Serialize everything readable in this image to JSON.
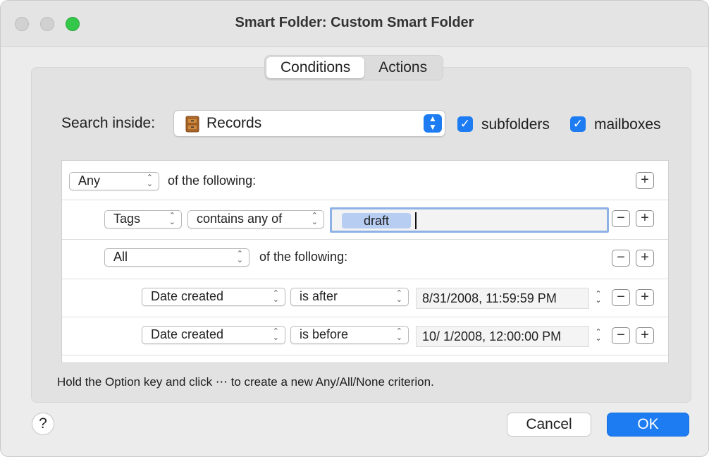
{
  "window": {
    "title": "Smart Folder: Custom Smart Folder"
  },
  "tabs": [
    {
      "label": "Conditions",
      "active": true
    },
    {
      "label": "Actions",
      "active": false
    }
  ],
  "search": {
    "label": "Search inside:",
    "location": "Records",
    "location_icon": "file-cabinet-icon",
    "subfolders": {
      "label": "subfolders",
      "checked": true
    },
    "mailboxes": {
      "label": "mailboxes",
      "checked": true
    }
  },
  "criteria": {
    "root": {
      "match": "Any",
      "suffix": "of the following:"
    },
    "rows": [
      {
        "field": "Tags",
        "operator": "contains any of",
        "token": "draft"
      },
      {
        "match": "All",
        "suffix": "of the following:"
      },
      {
        "field": "Date created",
        "operator": "is after",
        "value": "8/31/2008,  11:59:59 PM"
      },
      {
        "field": "Date created",
        "operator": "is before",
        "value": "10/  1/2008, 12:00:00 PM"
      }
    ]
  },
  "hint": "Hold the Option key and click ⋯ to create a new Any/All/None criterion.",
  "buttons": {
    "help": "?",
    "cancel": "Cancel",
    "ok": "OK"
  },
  "symbols": {
    "plus": "+",
    "minus": "−",
    "check": "✓"
  },
  "colors": {
    "accent": "#1d7cf2"
  }
}
